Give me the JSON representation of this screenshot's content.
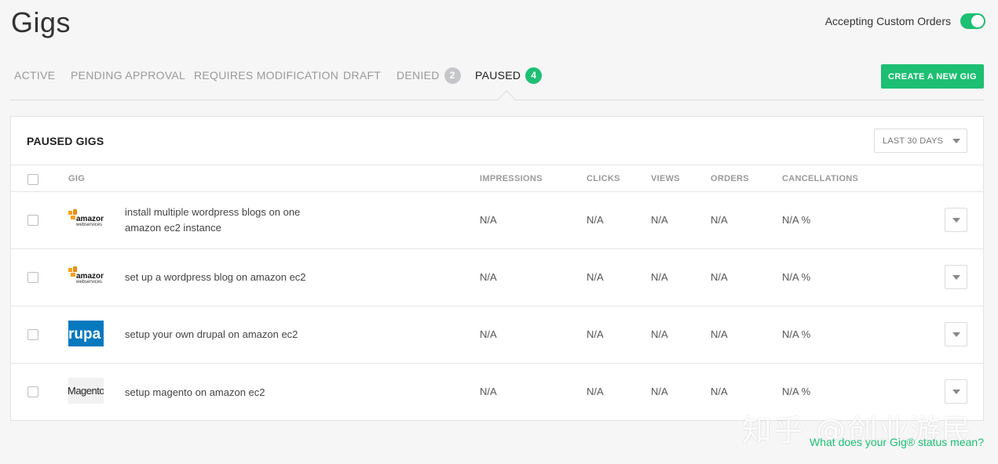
{
  "page": {
    "title": "Gigs"
  },
  "custom_orders": {
    "label": "Accepting Custom Orders",
    "enabled": true
  },
  "tabs": [
    {
      "label": "ACTIVE",
      "badge": ""
    },
    {
      "label": "PENDING APPROVAL",
      "badge": ""
    },
    {
      "label": "REQUIRES MODIFICATION",
      "badge": ""
    },
    {
      "label": "DRAFT",
      "badge": ""
    },
    {
      "label": "DENIED",
      "badge": "2"
    },
    {
      "label": "PAUSED",
      "badge": "4",
      "active": true
    }
  ],
  "create_button": {
    "label": "CREATE A NEW GIG"
  },
  "panel": {
    "title": "PAUSED GIGS",
    "date_filter": "LAST 30 DAYS",
    "columns": [
      "GIG",
      "IMPRESSIONS",
      "CLICKS",
      "VIEWS",
      "ORDERS",
      "CANCELLATIONS"
    ]
  },
  "gigs": [
    {
      "thumb_text": "amazon",
      "thumb_sub": "webservices",
      "title": "install multiple wordpress blogs on one amazon ec2 instance",
      "impressions": "N/A",
      "clicks": "N/A",
      "views": "N/A",
      "orders": "N/A",
      "cancellations": "N/A %"
    },
    {
      "thumb_text": "amazon",
      "thumb_sub": "webservices",
      "title": "set up a wordpress blog on amazon ec2",
      "impressions": "N/A",
      "clicks": "N/A",
      "views": "N/A",
      "orders": "N/A",
      "cancellations": "N/A %"
    },
    {
      "thumb_text": "rupa",
      "thumb_sub": "",
      "title": "setup your own drupal on amazon ec2",
      "impressions": "N/A",
      "clicks": "N/A",
      "views": "N/A",
      "orders": "N/A",
      "cancellations": "N/A %"
    },
    {
      "thumb_text": "Magento",
      "thumb_sub": "",
      "title": "setup magento on amazon ec2",
      "impressions": "N/A",
      "clicks": "N/A",
      "views": "N/A",
      "orders": "N/A",
      "cancellations": "N/A %"
    }
  ],
  "help_link": "What does your Gig® status mean?",
  "watermark": "知乎 @创业游民",
  "colors": {
    "accent": "#1dbf73",
    "badge_gray": "#c5c6c9",
    "amazon_orange": "#f7a01d",
    "drupal_blue": "#0678be"
  },
  "icons": {
    "row_menu": "chevron-down-icon",
    "date_filter": "chevron-down-icon"
  }
}
